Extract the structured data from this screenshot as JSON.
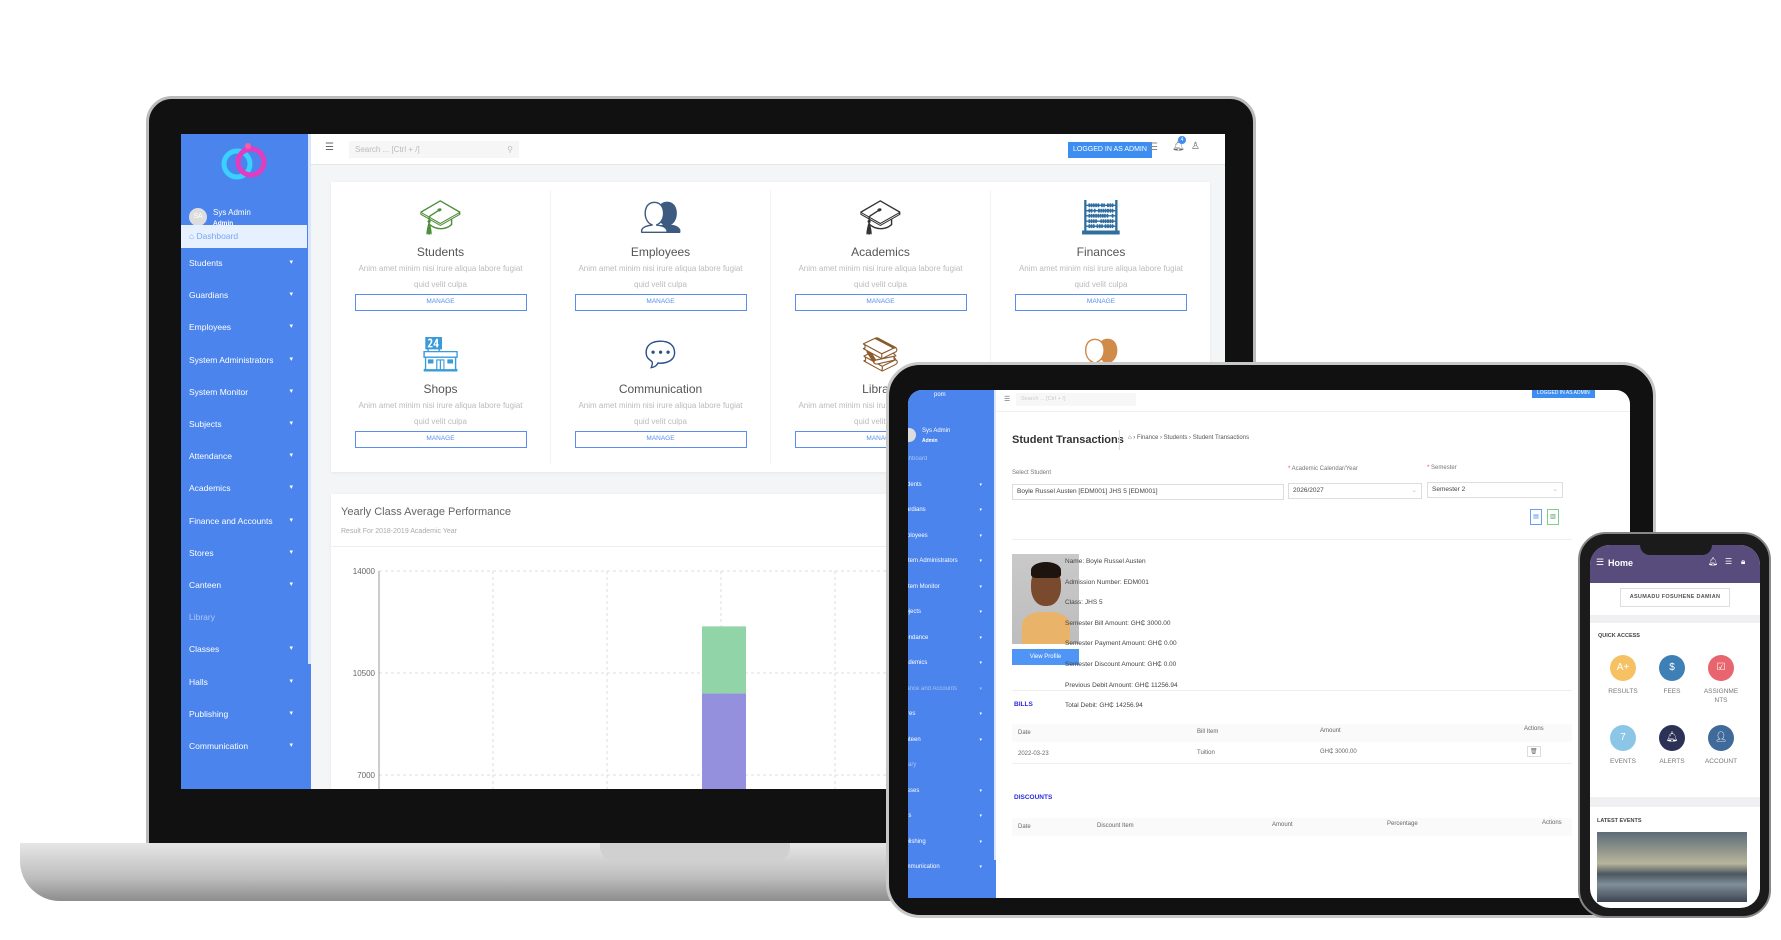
{
  "laptop": {
    "sidebar": {
      "user_initials": "SA",
      "user_name": "Sys Admin",
      "user_role": "Admin",
      "active_item": "Dashboard",
      "items": [
        "Students",
        "Guardians",
        "Employees",
        "System Administrators",
        "System Monitor",
        "Subjects",
        "Attendance",
        "Academics",
        "Finance and Accounts",
        "Stores",
        "Canteen",
        "Library",
        "Classes",
        "Halls",
        "Publishing",
        "Communication"
      ]
    },
    "topbar": {
      "search_placeholder": "Search ... [Ctrl + /]",
      "logged_in_label": "LOGGED IN AS ADMIN",
      "notification_count": "4"
    },
    "modules": [
      {
        "title": "Students",
        "desc": "Anim amet minim nisi irure aliqua labore fugiat quid velit culpa",
        "button": "MANAGE",
        "color": "#4e8f3a"
      },
      {
        "title": "Employees",
        "desc": "Anim amet minim nisi irure aliqua labore fugiat quid velit culpa",
        "button": "MANAGE",
        "color": "#3d5a80"
      },
      {
        "title": "Academics",
        "desc": "Anim amet minim nisi irure aliqua labore fugiat quid velit culpa",
        "button": "MANAGE",
        "color": "#333"
      },
      {
        "title": "Finances",
        "desc": "Anim amet minim nisi irure aliqua labore fugiat quid velit culpa",
        "button": "MANAGE",
        "color": "#2f6f9f"
      },
      {
        "title": "Shops",
        "desc": "Anim amet minim nisi irure aliqua labore fugiat quid velit culpa",
        "button": "MANAGE",
        "color": "#3b9bd9"
      },
      {
        "title": "Communication",
        "desc": "Anim amet minim nisi irure aliqua labore fugiat quid velit culpa",
        "button": "MANAGE",
        "color": "#2a4f8a"
      },
      {
        "title": "Library",
        "desc": "Anim amet minim nisi irure aliqua labore fugiat quid velit culpa",
        "button": "MANAGE",
        "color": "#8a5a2b"
      },
      {
        "title": "",
        "desc": "",
        "button": "",
        "color": "#d08a4a"
      }
    ],
    "chart": {
      "title": "Yearly Class Average Performance",
      "subtitle": "Result For 2018-2019 Academic Year"
    }
  },
  "chart_data": {
    "type": "bar",
    "stacked": true,
    "title": "Yearly Class Average Performance",
    "subtitle": "Result For 2018-2019 Academic Year",
    "yticks": [
      14000,
      10500,
      7000
    ],
    "ylim": [
      7000,
      14000
    ],
    "grid": true,
    "series": [
      {
        "color": "#9590dd",
        "values": [
          null,
          9800,
          null,
          null
        ]
      },
      {
        "color": "#90d4a8",
        "values": [
          null,
          12100,
          null,
          7100
        ]
      }
    ]
  },
  "tablet": {
    "sidebar": {
      "logo_text": "pom",
      "user_name": "Sys Admin",
      "user_role": "Admin",
      "items": [
        "Dashboard",
        "Students",
        "Guardians",
        "Employees",
        "System Administrators",
        "System Monitor",
        "Subjects",
        "Attendance",
        "Academics",
        "Finance and Accounts",
        "Stores",
        "Canteen",
        "Library",
        "Classes",
        "Halls",
        "Publishing",
        "Communication"
      ]
    },
    "topbar": {
      "search_placeholder": "Search ... [Ctrl + /]",
      "logged_in_label": "LOGGED IN AS ADMIN"
    },
    "page_title": "Student Transactions",
    "breadcrumb": [
      "Finance",
      "Students",
      "Student Transactions"
    ],
    "form": {
      "student_label": "Select Student",
      "student_value": "Boyle Russel Austen [EDM001] JHS 5 [EDM001]",
      "year_label": "Academic Calendar/Year",
      "year_value": "2026/2027",
      "semester_label": "Semester",
      "semester_value": "Semester 2"
    },
    "profile": {
      "view_button": "View Profile",
      "fields": [
        {
          "k": "Name",
          "v": "Boyle Russel Austen"
        },
        {
          "k": "Admission Number",
          "v": "EDM001"
        },
        {
          "k": "Class",
          "v": "JHS 5"
        },
        {
          "k": "Semester Bill Amount",
          "v": "GH₵ 3000.00"
        },
        {
          "k": "Semester Payment Amount",
          "v": "GH₵ 0.00"
        },
        {
          "k": "Semester Discount Amount",
          "v": "GH₵ 0.00"
        },
        {
          "k": "Previous Debit Amount",
          "v": "GH₵ 11256.94"
        },
        {
          "k": "Total Debit",
          "v": "GH₵ 14256.94"
        }
      ]
    },
    "bills": {
      "title": "BILLS",
      "columns": [
        "Date",
        "Bill Item",
        "Amount",
        "Actions"
      ],
      "rows": [
        {
          "date": "2022-03-23",
          "item": "Tuition",
          "amount": "GH₵ 3000.00"
        }
      ]
    },
    "discounts": {
      "title": "DISCOUNTS",
      "columns": [
        "Date",
        "Discount Item",
        "Amount",
        "Percentage",
        "Actions"
      ]
    }
  },
  "phone": {
    "header": "Home",
    "user_button": "ASUMADU FOSUHENE DAMIAN",
    "quick_access": "QUICK ACCESS",
    "tiles": [
      {
        "label": "RESULTS",
        "color": "#f5c163"
      },
      {
        "label": "FEES",
        "color": "#3e7fb5"
      },
      {
        "label": "ASSIGNMENTS",
        "color": "#e8646e"
      },
      {
        "label": "EVENTS",
        "color": "#8cc6e6"
      },
      {
        "label": "ALERTS",
        "color": "#2b3256"
      },
      {
        "label": "ACCOUNT",
        "color": "#3f6a99"
      }
    ],
    "latest_events": "LATEST EVENTS"
  },
  "colors": {
    "sidebar": "#4a84ec",
    "accent": "#3d8ef0",
    "phone_header": "#574c7c"
  }
}
